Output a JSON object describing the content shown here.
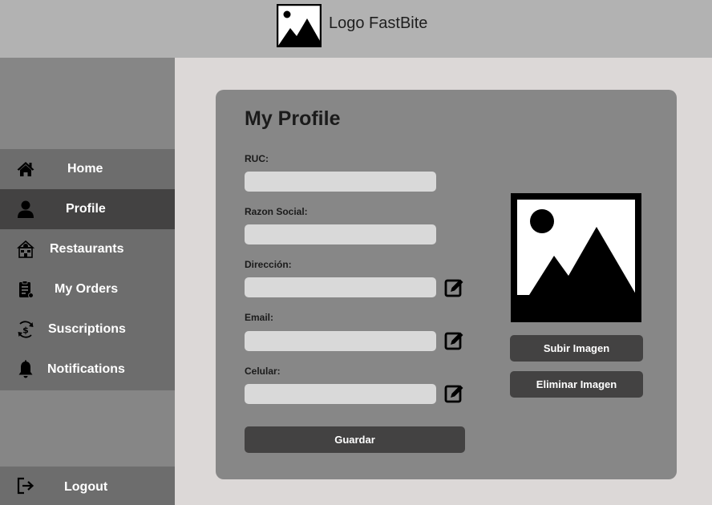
{
  "header": {
    "logo_icon": "image-placeholder-icon",
    "logo_text": "Logo FastBite"
  },
  "sidebar": {
    "items": [
      {
        "label": "Home",
        "icon": "home-icon",
        "active": false
      },
      {
        "label": "Profile",
        "icon": "user-icon",
        "active": true
      },
      {
        "label": "Restaurants",
        "icon": "restaurant-icon",
        "active": false
      },
      {
        "label": "My Orders",
        "icon": "orders-icon",
        "active": false
      },
      {
        "label": "Suscriptions",
        "icon": "subscription-icon",
        "active": false
      },
      {
        "label": "Notifications",
        "icon": "bell-icon",
        "active": false
      }
    ],
    "logout": {
      "label": "Logout",
      "icon": "logout-icon"
    }
  },
  "profile": {
    "title": "My Profile",
    "fields": [
      {
        "label": "RUC:",
        "value": "",
        "editable": false
      },
      {
        "label": "Razon Social:",
        "value": "",
        "editable": false
      },
      {
        "label": "Dirección:",
        "value": "",
        "editable": true
      },
      {
        "label": "Email:",
        "value": "",
        "editable": true
      },
      {
        "label": "Celular:",
        "value": "",
        "editable": true
      }
    ],
    "save_label": "Guardar",
    "avatar_icon": "image-placeholder-icon",
    "upload_label": "Subir Imagen",
    "remove_label": "Eliminar Imagen"
  },
  "colors": {
    "topbar": "#b2b2b2",
    "sidebar": "#868686",
    "nav_background": "#6d6d6d",
    "nav_active": "#434242",
    "page_background": "#dcd8d7",
    "card": "#878787",
    "input": "#d9d9d9",
    "button": "#434242"
  }
}
